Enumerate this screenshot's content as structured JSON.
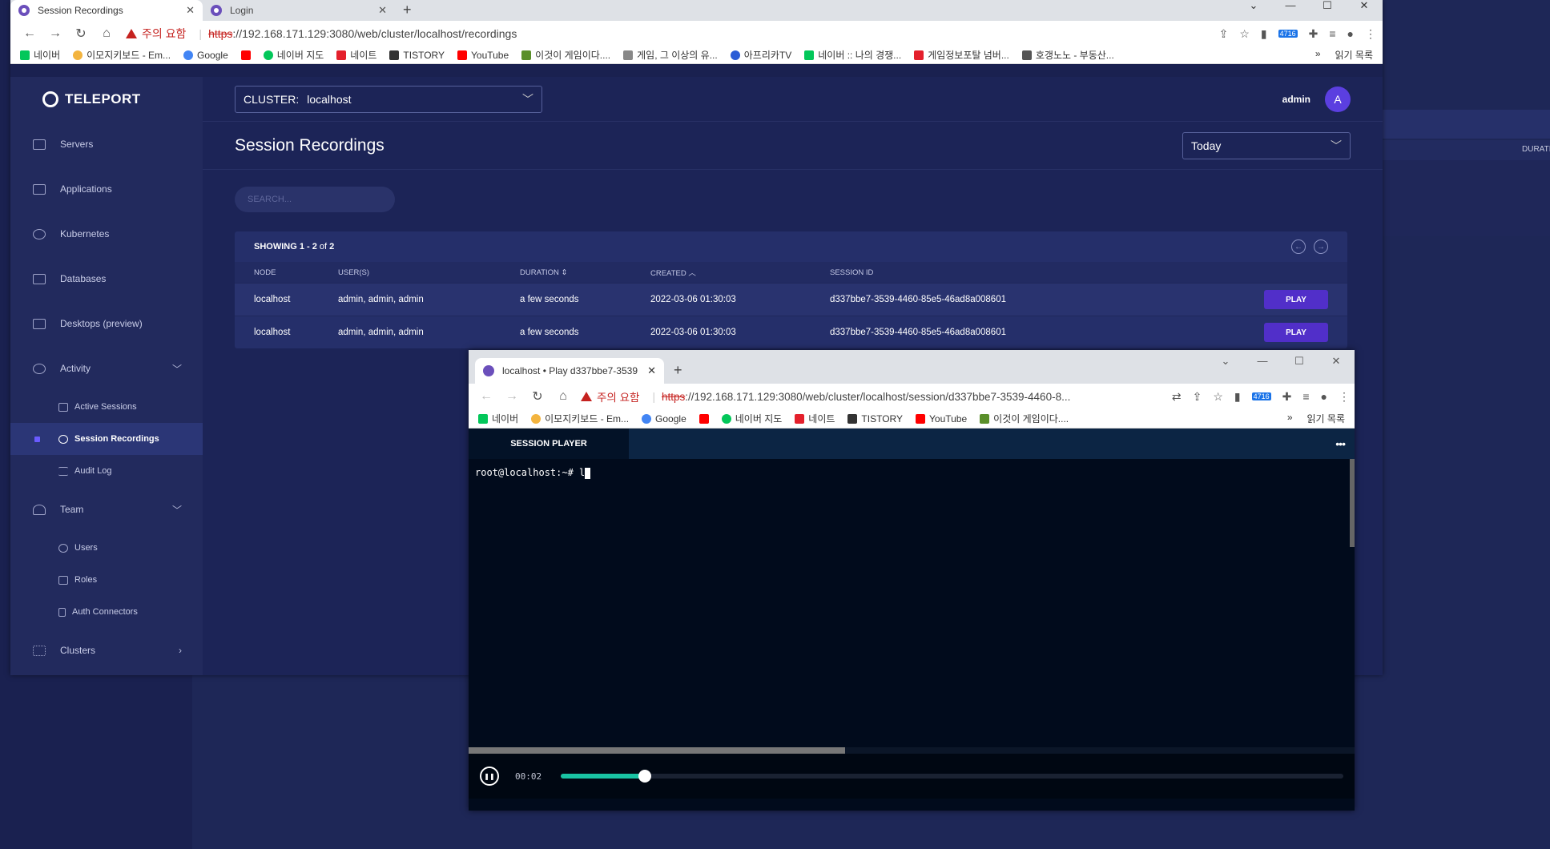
{
  "browser": {
    "tabs": [
      {
        "title": "Session Recordings"
      },
      {
        "title": "Login"
      }
    ],
    "warning": "주의 요함",
    "url_scheme": "https",
    "url_rest": "://192.168.171.129:3080/web/cluster/localhost/recordings",
    "ext_badge": "4716",
    "bookmarks": [
      "네이버",
      "이모지키보드 - Em...",
      "Google",
      "네이버 지도",
      "네이트",
      "TISTORY",
      "YouTube",
      "이것이 게임이다....",
      "게임, 그 이상의 유...",
      "아프리카TV",
      "네이버 :: 나의 경쟁...",
      "게임정보포탈 넘버...",
      "호갱노노 - 부동산..."
    ],
    "reading_list": "읽기 목록",
    "more": "»"
  },
  "app": {
    "brand": "TELEPORT",
    "nav": [
      {
        "label": "Servers"
      },
      {
        "label": "Applications"
      },
      {
        "label": "Kubernetes"
      },
      {
        "label": "Databases"
      },
      {
        "label": "Desktops (preview)"
      },
      {
        "label": "Activity"
      }
    ],
    "activity_sub": [
      {
        "label": "Active Sessions"
      },
      {
        "label": "Session Recordings"
      },
      {
        "label": "Audit Log"
      }
    ],
    "team": "Team",
    "team_sub": [
      {
        "label": "Users"
      },
      {
        "label": "Roles"
      },
      {
        "label": "Auth Connectors"
      }
    ],
    "clusters": "Clusters",
    "cluster_label": "CLUSTER:",
    "cluster_value": "localhost",
    "user_name": "admin",
    "avatar_letter": "A",
    "page_title": "Session Recordings",
    "range": "Today",
    "search_placeholder": "SEARCH...",
    "showing_prefix": "SHOWING ",
    "showing_range": "1 - 2",
    "showing_of": " of ",
    "showing_total": "2",
    "columns": [
      "NODE",
      "USER(S)",
      "DURATION",
      "CREATED",
      "SESSION ID"
    ],
    "rows": [
      {
        "node": "localhost",
        "users": "admin, admin, admin",
        "duration": "a few seconds",
        "created": "2022-03-06 01:30:03",
        "session_id": "d337bbe7-3539-4460-85e5-46ad8a008601",
        "action": "PLAY"
      },
      {
        "node": "localhost",
        "users": "admin, admin, admin",
        "duration": "a few seconds",
        "created": "2022-03-06 01:30:03",
        "session_id": "d337bbe7-3539-4460-85e5-46ad8a008601",
        "action": "PLAY"
      }
    ]
  },
  "popup": {
    "tab_title": "localhost • Play d337bbe7-3539",
    "warning": "주의 요함",
    "url_scheme": "https",
    "url_rest": "://192.168.171.129:3080/web/cluster/localhost/session/d337bbe7-3539-4460-8...",
    "ext_badge": "4716",
    "bookmarks": [
      "네이버",
      "이모지키보드 - Em...",
      "Google",
      "네이버 지도",
      "네이트",
      "TISTORY",
      "YouTube",
      "이것이 게임이다...."
    ],
    "reading_list": "읽기 목록",
    "more": "»",
    "player_tab": "SESSION PLAYER",
    "menu": "•••",
    "terminal_line": "root@localhost:~# l",
    "time": "00:02",
    "progress": 0.107
  },
  "background": {
    "duration_col": "DURATI"
  }
}
